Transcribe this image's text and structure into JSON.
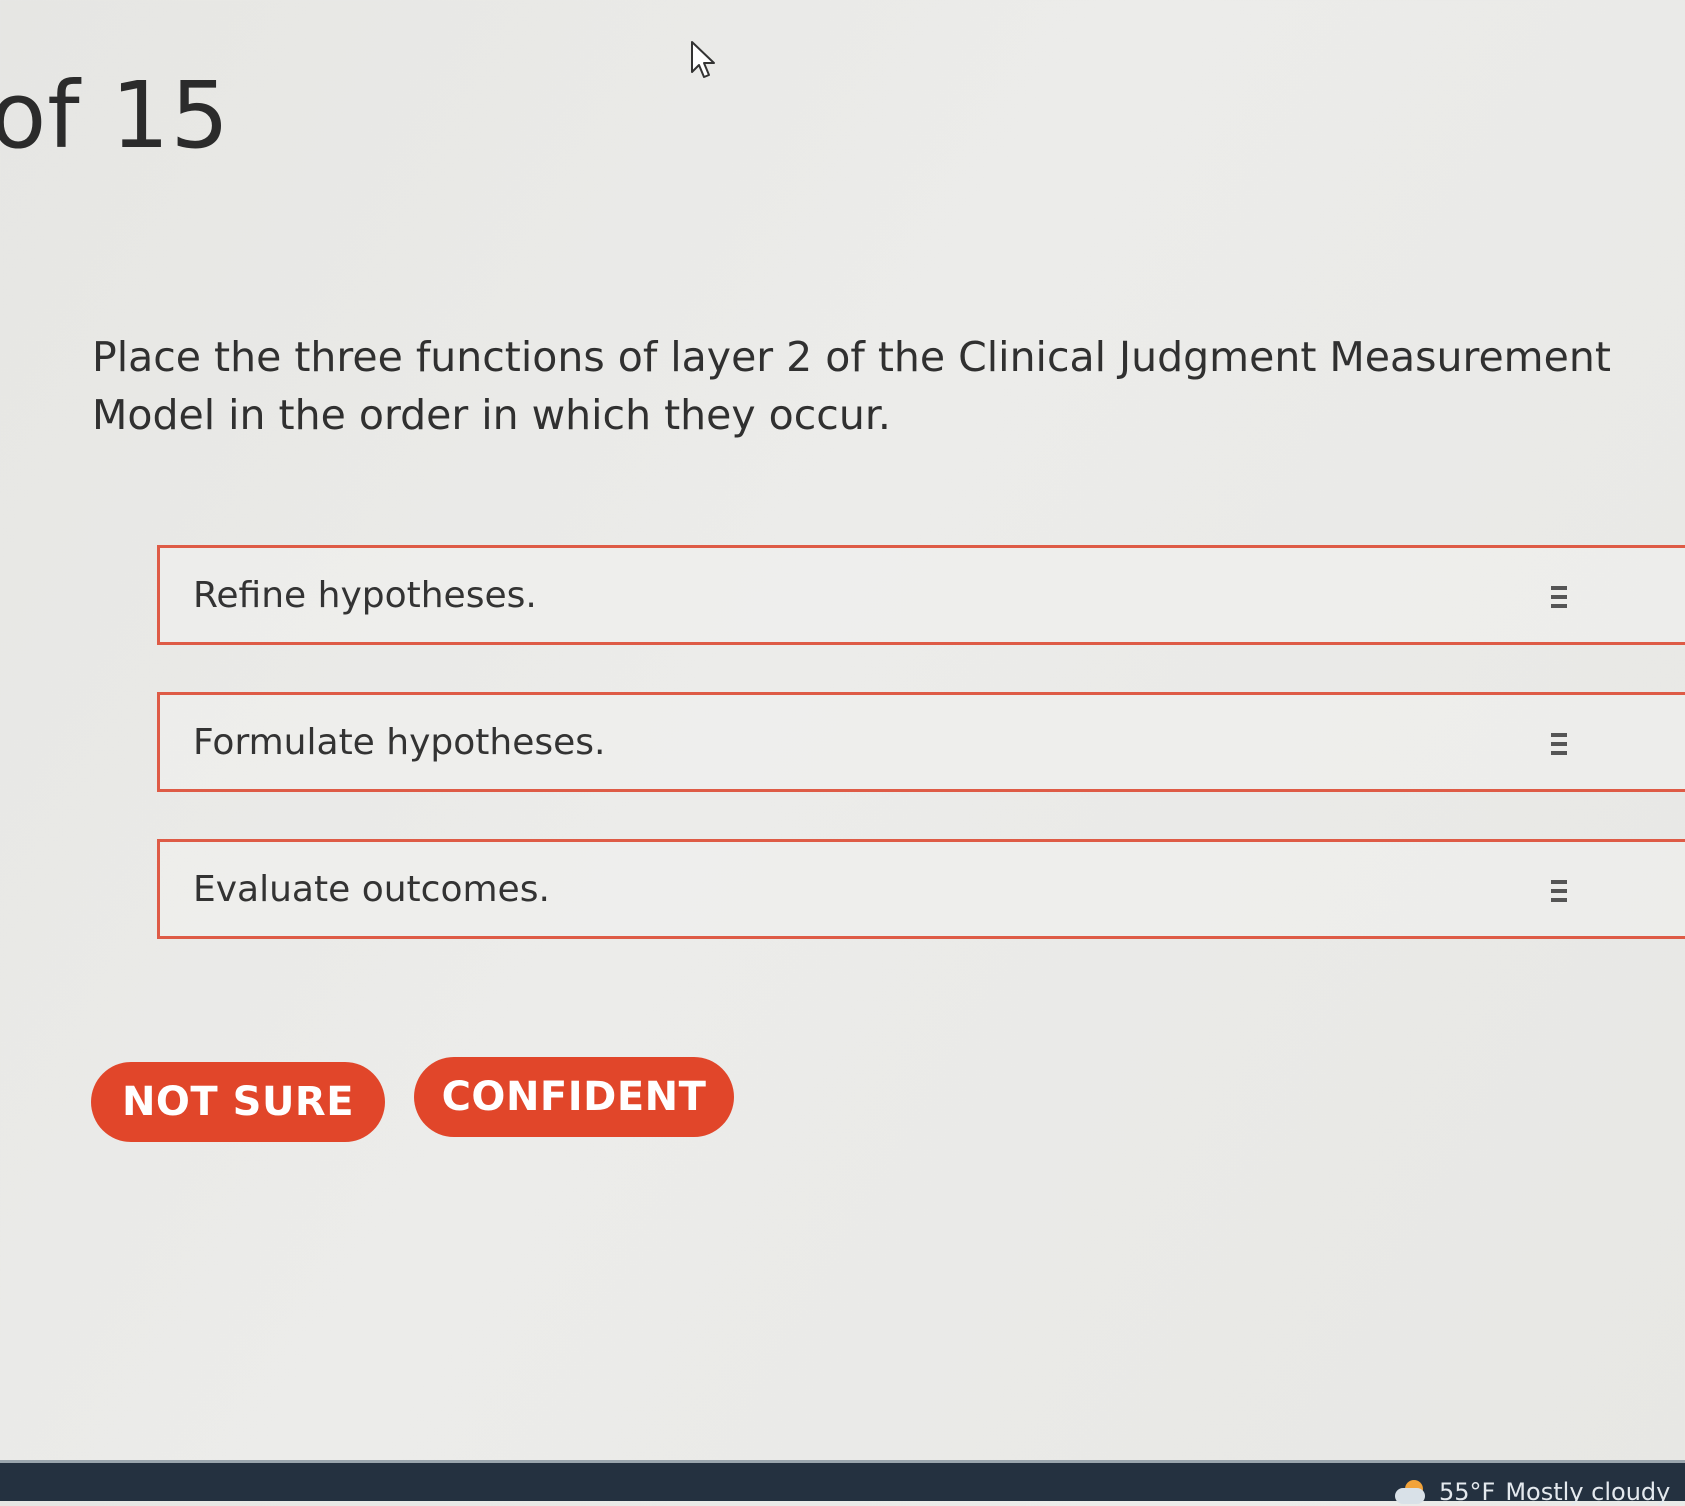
{
  "header": {
    "counter": "of 15"
  },
  "question": {
    "text": "Place the three functions of layer 2 of the Clinical Judgment Measurement Model in the order in which they occur."
  },
  "options": [
    {
      "label": "Refine hypotheses."
    },
    {
      "label": "Formulate hypotheses."
    },
    {
      "label": "Evaluate outcomes."
    }
  ],
  "buttons": {
    "not_sure": "NOT SURE",
    "confident": "CONFIDENT"
  },
  "colors": {
    "accent": "#e1462a",
    "option_border": "#de5b46",
    "taskbar": "#243140"
  },
  "icons": {
    "cursor": "mouse-pointer-icon",
    "drag": "drag-handle-icon",
    "weather": "partly-cloudy-icon"
  },
  "taskbar": {
    "temperature": "55°F",
    "condition": "Mostly cloudy"
  }
}
